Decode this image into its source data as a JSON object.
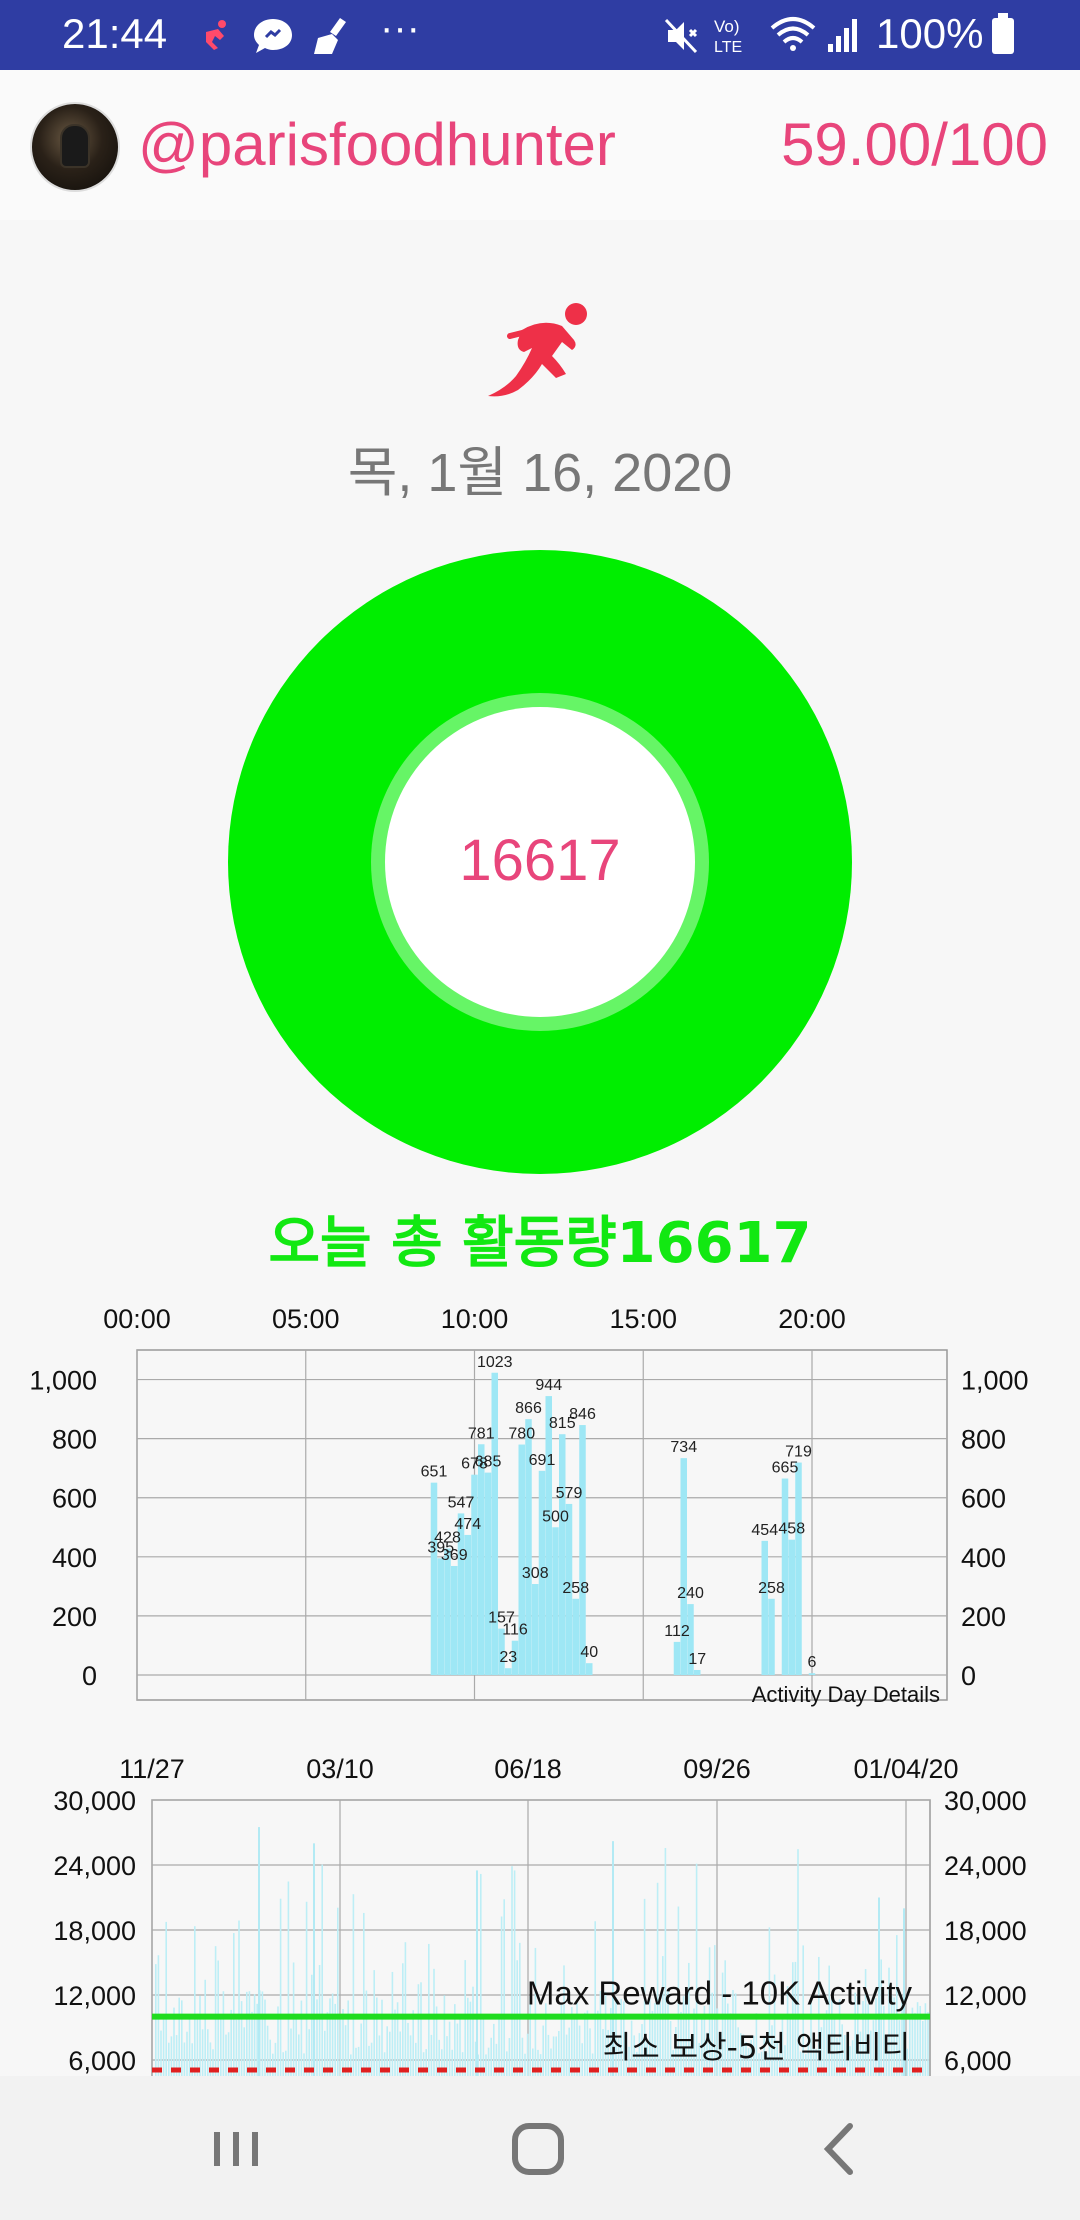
{
  "status_bar": {
    "time": "21:44",
    "battery": "100%",
    "more": "···",
    "icons": [
      "runner-icon",
      "chat-icon",
      "broom-icon",
      "mute-icon",
      "volte-icon",
      "wifi-icon",
      "signal-icon",
      "battery-icon"
    ]
  },
  "header": {
    "username": "@parisfoodhunter",
    "score": "59.00/100"
  },
  "main": {
    "date": "목, 1월 16, 2020",
    "total_steps": "16617",
    "summary": "오늘 총 활동량16617",
    "colors": {
      "accent": "#e8457b",
      "ring": "#00ee00",
      "summary": "#12e812",
      "bar": "#9ee7f5"
    }
  },
  "chart_data": [
    {
      "type": "bar",
      "title": "",
      "legend_text": "Activity Day Details",
      "x_ticks": [
        "00:00",
        "05:00",
        "10:00",
        "15:00",
        "20:00"
      ],
      "y_ticks": [
        "0",
        "200",
        "400",
        "600",
        "800",
        "1,000"
      ],
      "ylim": [
        0,
        1100
      ],
      "x_range_hours": [
        0,
        24
      ],
      "grid": true,
      "points": [
        {
          "hour": 8.8,
          "value": 651,
          "label": "651"
        },
        {
          "hour": 9.0,
          "value": 395,
          "label": "395"
        },
        {
          "hour": 9.2,
          "value": 428,
          "label": "428"
        },
        {
          "hour": 9.4,
          "value": 369,
          "label": "369"
        },
        {
          "hour": 9.6,
          "value": 547,
          "label": "547"
        },
        {
          "hour": 9.8,
          "value": 474,
          "label": "474"
        },
        {
          "hour": 10.0,
          "value": 678,
          "label": "678"
        },
        {
          "hour": 10.2,
          "value": 781,
          "label": "781"
        },
        {
          "hour": 10.4,
          "value": 685,
          "label": "685"
        },
        {
          "hour": 10.6,
          "value": 1023,
          "label": "1023"
        },
        {
          "hour": 10.8,
          "value": 157,
          "label": "157"
        },
        {
          "hour": 11.0,
          "value": 23,
          "label": "23"
        },
        {
          "hour": 11.2,
          "value": 116,
          "label": "116"
        },
        {
          "hour": 11.4,
          "value": 780,
          "label": "780"
        },
        {
          "hour": 11.6,
          "value": 866,
          "label": "866"
        },
        {
          "hour": 11.8,
          "value": 308,
          "label": "308"
        },
        {
          "hour": 12.0,
          "value": 691,
          "label": "691"
        },
        {
          "hour": 12.2,
          "value": 944,
          "label": "944"
        },
        {
          "hour": 12.4,
          "value": 500,
          "label": "500"
        },
        {
          "hour": 12.6,
          "value": 815,
          "label": "815"
        },
        {
          "hour": 12.8,
          "value": 579,
          "label": "579"
        },
        {
          "hour": 13.0,
          "value": 258,
          "label": "258"
        },
        {
          "hour": 13.2,
          "value": 846,
          "label": "846"
        },
        {
          "hour": 13.4,
          "value": 40,
          "label": "40"
        },
        {
          "hour": 16.0,
          "value": 112,
          "label": "112"
        },
        {
          "hour": 16.2,
          "value": 734,
          "label": "734"
        },
        {
          "hour": 16.4,
          "value": 240,
          "label": "240"
        },
        {
          "hour": 16.6,
          "value": 17,
          "label": "17"
        },
        {
          "hour": 18.6,
          "value": 454,
          "label": "454"
        },
        {
          "hour": 18.8,
          "value": 258,
          "label": "258"
        },
        {
          "hour": 19.2,
          "value": 665,
          "label": "665"
        },
        {
          "hour": 19.4,
          "value": 458,
          "label": "458"
        },
        {
          "hour": 19.6,
          "value": 719,
          "label": "719"
        },
        {
          "hour": 20.0,
          "value": 6,
          "label": "6"
        }
      ]
    },
    {
      "type": "bar",
      "title": "",
      "x_ticks": [
        "11/27",
        "03/10",
        "06/18",
        "09/26",
        "01/04/20"
      ],
      "y_ticks": [
        "6,000",
        "12,000",
        "18,000",
        "24,000",
        "30,000"
      ],
      "ylim_visible": [
        6000,
        30000
      ],
      "grid": true,
      "reference_lines": [
        {
          "label": "Max Reward - 10K Activity",
          "value": 10000,
          "color": "#1fdc1f",
          "style": "solid"
        },
        {
          "label": "최소 보상-5천 액티비티",
          "value": 5000,
          "color": "#e02020",
          "style": "dashed"
        }
      ]
    }
  ],
  "nav": {
    "buttons": [
      "recent-apps-icon",
      "home-icon",
      "back-icon"
    ]
  }
}
